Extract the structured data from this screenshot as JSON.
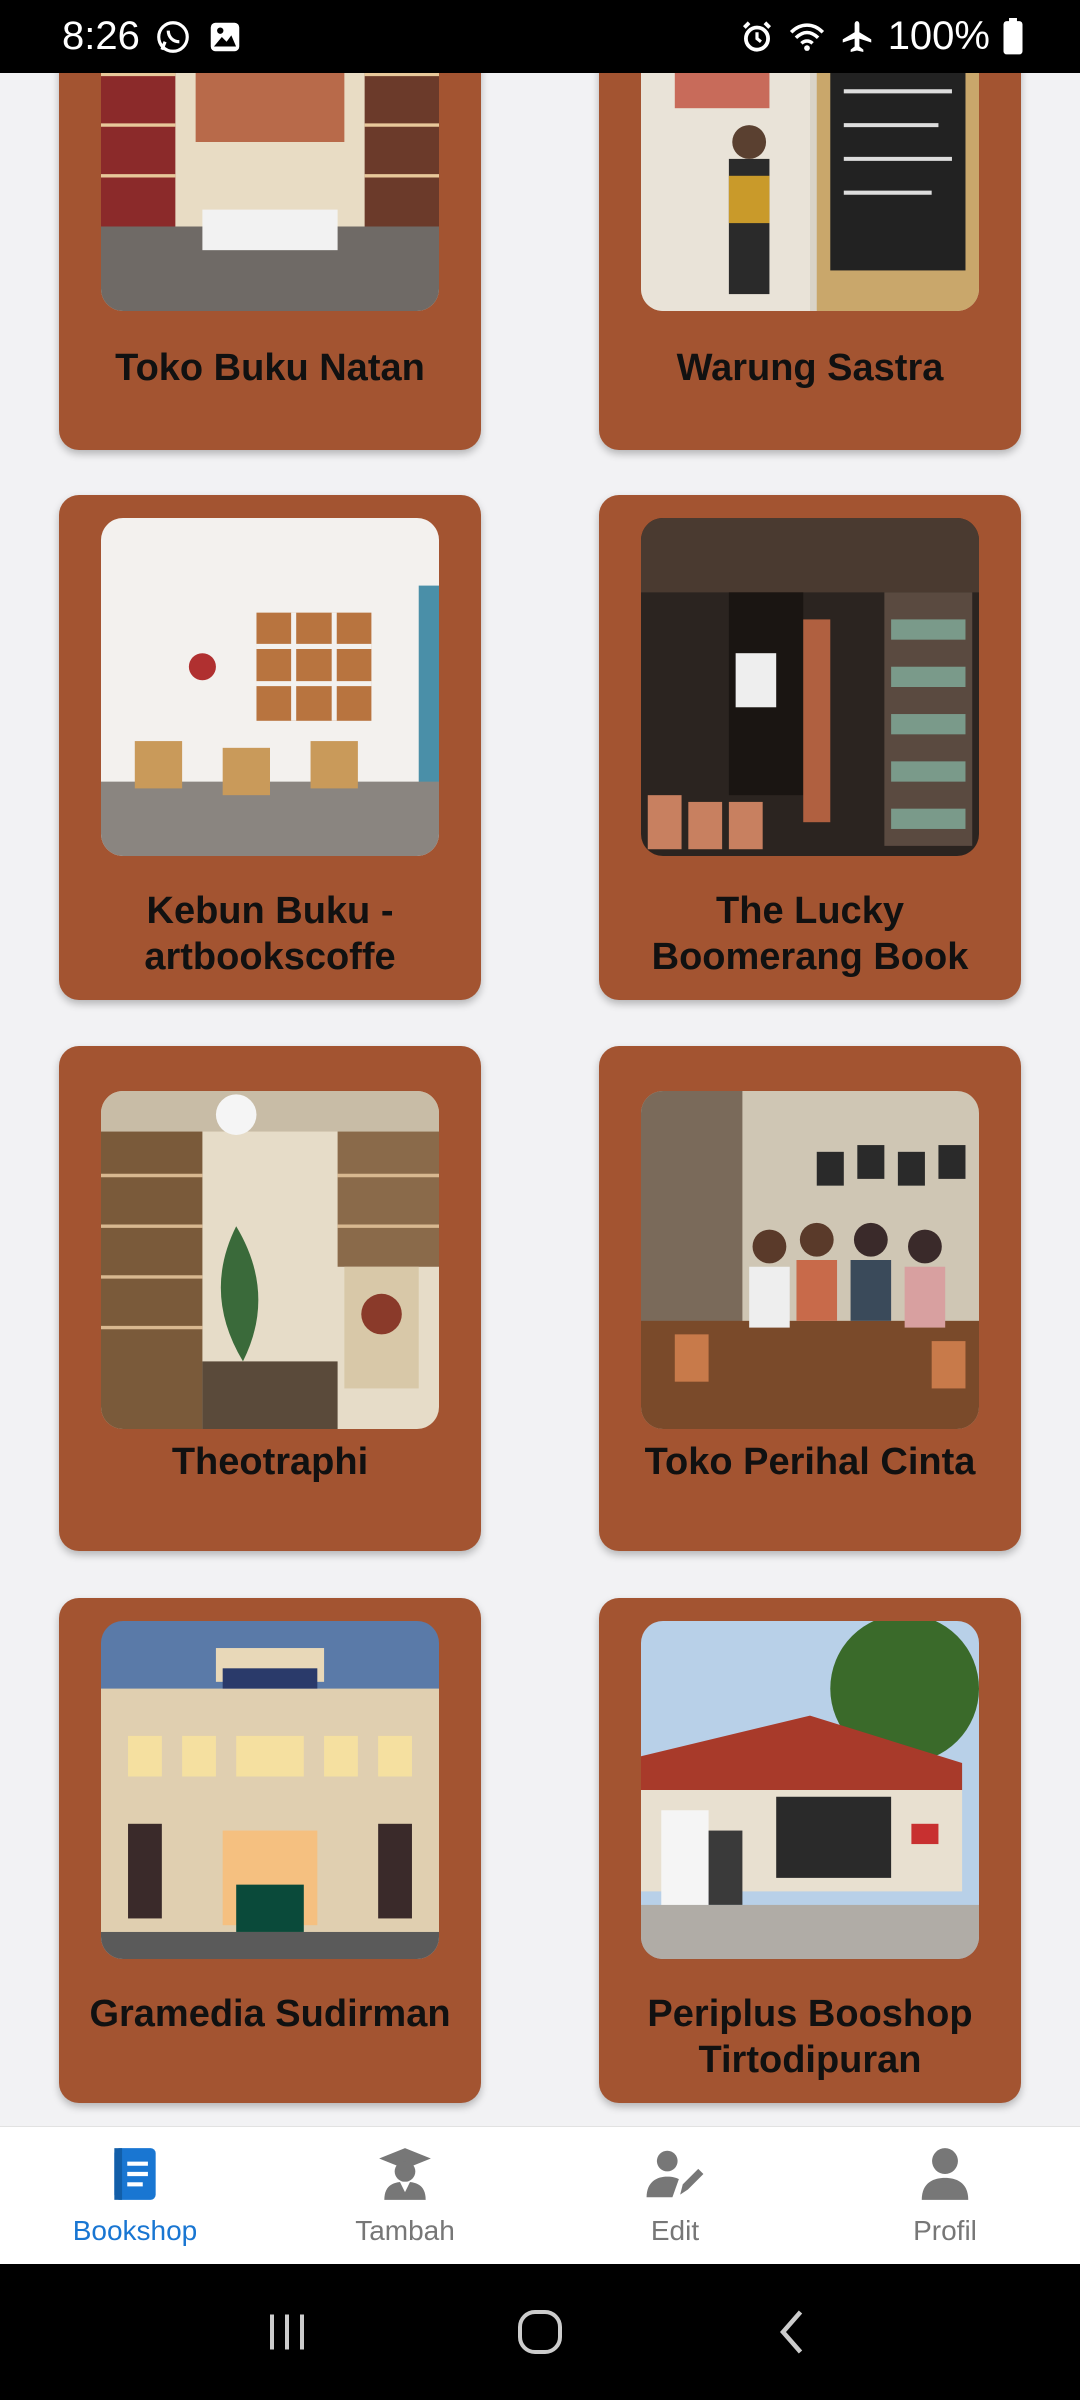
{
  "status": {
    "time": "8:26",
    "battery": "100%"
  },
  "colors": {
    "card_bg": "#a35431",
    "accent": "#1976d2",
    "nav_inactive": "#777777"
  },
  "cards": [
    {
      "title": "Toko Buku Natan",
      "image": "bookstore-interior-red-shelves"
    },
    {
      "title": "Warung Sastra",
      "image": "cafe-with-poem-chalkboard"
    },
    {
      "title": "Kebun Buku - artbookscoffe",
      "image": "white-room-with-chairs-and-shelves"
    },
    {
      "title": "The Lucky Boomerang Book",
      "image": "dark-shop-front-with-books"
    },
    {
      "title": "Theotraphi",
      "image": "library-shelves-with-plants"
    },
    {
      "title": "Toko Perihal Cinta",
      "image": "people-sitting-at-wooden-tables"
    },
    {
      "title": "Gramedia Sudirman",
      "image": "gramedia-building-at-dusk"
    },
    {
      "title": "Periplus Booshop Tirtodipuran",
      "image": "red-roof-shop-exterior"
    }
  ],
  "nav": {
    "items": [
      {
        "label": "Bookshop",
        "icon": "book-icon",
        "active": true
      },
      {
        "label": "Tambah",
        "icon": "graduate-icon",
        "active": false
      },
      {
        "label": "Edit",
        "icon": "user-edit-icon",
        "active": false
      },
      {
        "label": "Profil",
        "icon": "user-icon",
        "active": false
      }
    ]
  }
}
